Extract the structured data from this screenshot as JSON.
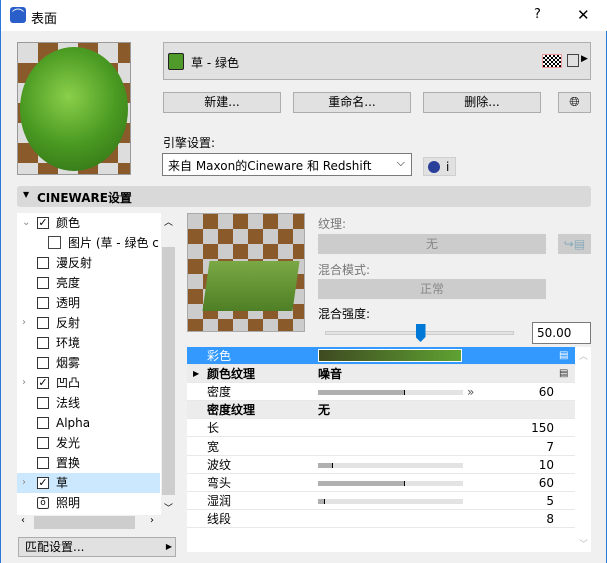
{
  "window": {
    "title": "表面",
    "help": "?",
    "close": "✕"
  },
  "surface": {
    "name": "草 - 绿色",
    "swatch_color": "#4f9a2a"
  },
  "buttons": {
    "new": "新建...",
    "rename": "重命名...",
    "delete": "删除..."
  },
  "engine": {
    "label": "引擎设置:",
    "value": "来自 Maxon的Cineware 和 Redshift",
    "info": "i"
  },
  "section": {
    "title": "CINEWARE设置"
  },
  "tree": [
    {
      "label": "颜色",
      "checked": true,
      "expand": "open"
    },
    {
      "label": "图片 (草 - 绿色 cl",
      "type": "image"
    },
    {
      "label": "漫反射",
      "checked": false
    },
    {
      "label": "亮度",
      "checked": false
    },
    {
      "label": "透明",
      "checked": false
    },
    {
      "label": "反射",
      "checked": false,
      "expand": "closed"
    },
    {
      "label": "环境",
      "checked": false
    },
    {
      "label": "烟雾",
      "checked": false
    },
    {
      "label": "凹凸",
      "checked": true,
      "expand": "closed"
    },
    {
      "label": "法线",
      "checked": false
    },
    {
      "label": "Alpha",
      "checked": false
    },
    {
      "label": "发光",
      "checked": false
    },
    {
      "label": "置换",
      "checked": false
    },
    {
      "label": "草",
      "checked": true,
      "expand": "closed",
      "selected": true
    },
    {
      "label": "照明",
      "type": "light"
    }
  ],
  "match_button": "匹配设置...",
  "texture": {
    "label": "纹理:",
    "value": "无",
    "blend_mode_label": "混合模式:",
    "blend_mode": "正常",
    "blend_strength_label": "混合强度:",
    "blend_strength": "50.00",
    "blend_strength_fraction": 0.5
  },
  "props": [
    {
      "label": "彩色",
      "type": "gradient",
      "selected": true
    },
    {
      "label": "颜色纹理",
      "value": "噪音",
      "group": true,
      "expand": true
    },
    {
      "label": "密度",
      "slider": 0.6,
      "number": "60"
    },
    {
      "label": "密度纹理",
      "value": "无",
      "group": true
    },
    {
      "label": "长",
      "number": "150"
    },
    {
      "label": "宽",
      "number": "7"
    },
    {
      "label": "波纹",
      "slider": 0.1,
      "number": "10"
    },
    {
      "label": "弯头",
      "slider": 0.6,
      "number": "60"
    },
    {
      "label": "湿润",
      "slider": 0.05,
      "number": "5"
    },
    {
      "label": "线段",
      "number": "8"
    }
  ],
  "colors": {
    "accent": "#3399ff",
    "gradient_start": "#3e4a20",
    "gradient_end": "#5fa232"
  }
}
